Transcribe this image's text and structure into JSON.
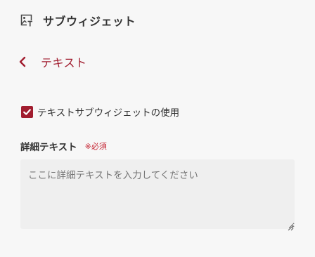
{
  "header": {
    "title": "サブウィジェット",
    "icon": "image-text-icon"
  },
  "back": {
    "label": "テキスト",
    "icon": "chevron-left-icon"
  },
  "subwidget_toggle": {
    "label": "テキストサブウィジェットの使用",
    "checked": true
  },
  "detail_field": {
    "label": "詳細テキスト",
    "required_label": "※必須",
    "placeholder": "ここに詳細テキストを入力してください"
  },
  "colors": {
    "accent": "#a11d2f",
    "required": "#c62634",
    "background": "#f7f7f7",
    "field_bg": "#efefef"
  }
}
